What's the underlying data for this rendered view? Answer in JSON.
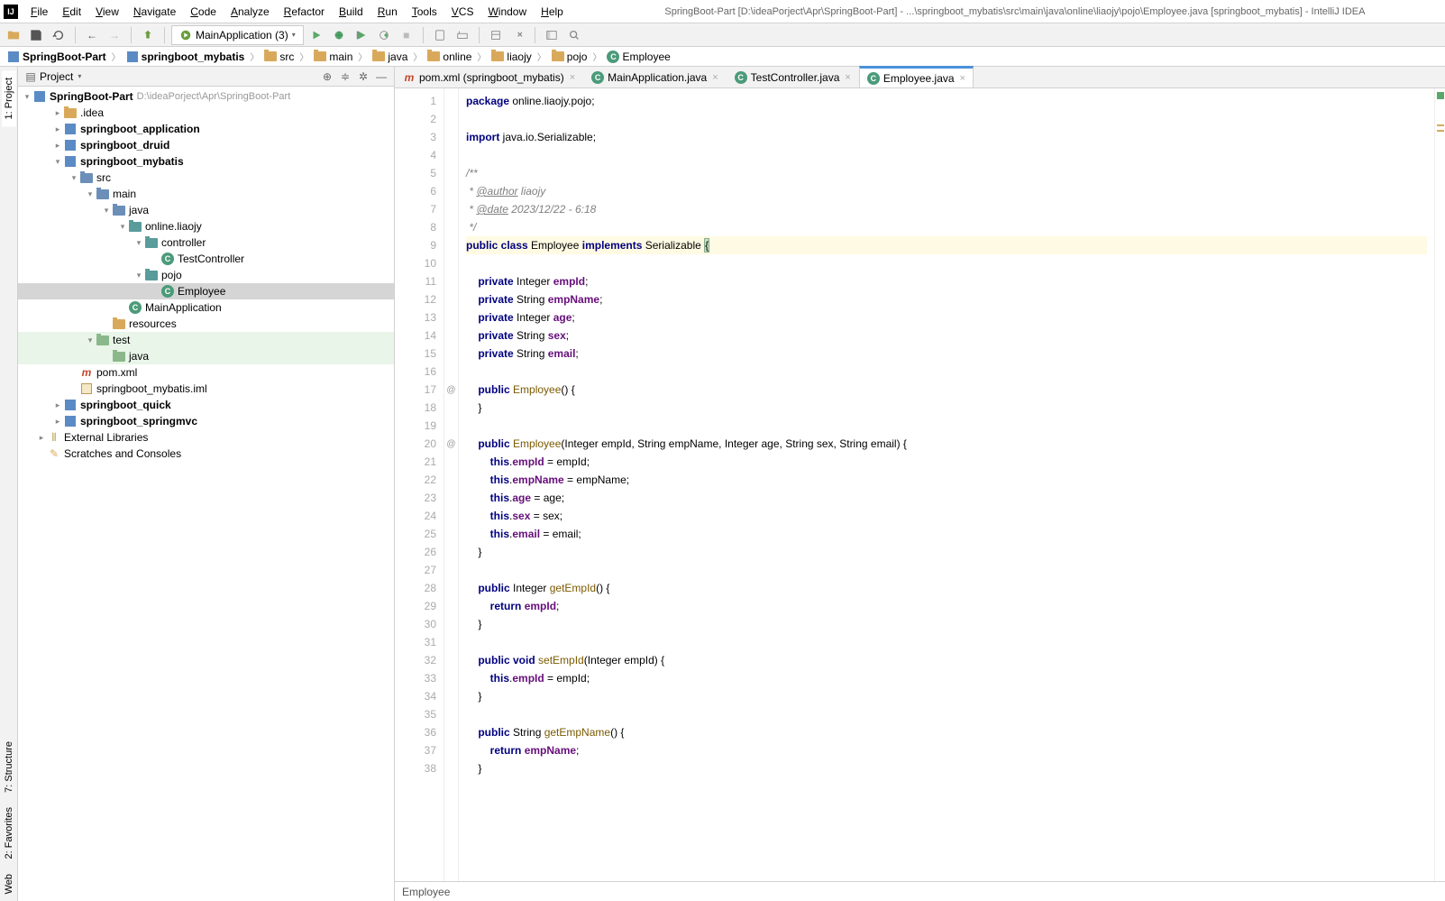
{
  "window": {
    "title": "SpringBoot-Part [D:\\ideaPorject\\Apr\\SpringBoot-Part] - ...\\springboot_mybatis\\src\\main\\java\\online\\liaojy\\pojo\\Employee.java [springboot_mybatis] - IntelliJ IDEA"
  },
  "menu": [
    "File",
    "Edit",
    "View",
    "Navigate",
    "Code",
    "Analyze",
    "Refactor",
    "Build",
    "Run",
    "Tools",
    "VCS",
    "Window",
    "Help"
  ],
  "run_config": "MainApplication (3)",
  "breadcrumb": [
    "SpringBoot-Part",
    "springboot_mybatis",
    "src",
    "main",
    "java",
    "online",
    "liaojy",
    "pojo",
    "Employee"
  ],
  "project_panel": {
    "title": "Project",
    "root": {
      "name": "SpringBoot-Part",
      "hint": "D:\\ideaPorject\\Apr\\SpringBoot-Part"
    },
    "items": [
      {
        "indent": 1,
        "arrow": ">",
        "icon": "folder",
        "label": ".idea"
      },
      {
        "indent": 1,
        "arrow": ">",
        "icon": "module",
        "label": "springboot_application",
        "bold": true
      },
      {
        "indent": 1,
        "arrow": ">",
        "icon": "module",
        "label": "springboot_druid",
        "bold": true
      },
      {
        "indent": 1,
        "arrow": "v",
        "icon": "module",
        "label": "springboot_mybatis",
        "bold": true
      },
      {
        "indent": 2,
        "arrow": "v",
        "icon": "folder-blue",
        "label": "src"
      },
      {
        "indent": 3,
        "arrow": "v",
        "icon": "folder-blue",
        "label": "main"
      },
      {
        "indent": 4,
        "arrow": "v",
        "icon": "folder-blue",
        "label": "java"
      },
      {
        "indent": 5,
        "arrow": "v",
        "icon": "folder-teal",
        "label": "online.liaojy"
      },
      {
        "indent": 6,
        "arrow": "v",
        "icon": "folder-teal",
        "label": "controller"
      },
      {
        "indent": 7,
        "arrow": "",
        "icon": "class",
        "label": "TestController"
      },
      {
        "indent": 6,
        "arrow": "v",
        "icon": "folder-teal",
        "label": "pojo"
      },
      {
        "indent": 7,
        "arrow": "",
        "icon": "class",
        "label": "Employee",
        "selected": true
      },
      {
        "indent": 5,
        "arrow": "",
        "icon": "class-run",
        "label": "MainApplication"
      },
      {
        "indent": 4,
        "arrow": "",
        "icon": "folder",
        "label": "resources"
      },
      {
        "indent": 3,
        "arrow": "v",
        "icon": "folder-green",
        "label": "test",
        "test": true
      },
      {
        "indent": 4,
        "arrow": "",
        "icon": "folder-green",
        "label": "java",
        "test": true
      },
      {
        "indent": 2,
        "arrow": "",
        "icon": "maven",
        "label": "pom.xml"
      },
      {
        "indent": 2,
        "arrow": "",
        "icon": "iml",
        "label": "springboot_mybatis.iml"
      },
      {
        "indent": 1,
        "arrow": ">",
        "icon": "module",
        "label": "springboot_quick",
        "bold": true
      },
      {
        "indent": 1,
        "arrow": ">",
        "icon": "module",
        "label": "springboot_springmvc",
        "bold": true
      },
      {
        "indent": 0,
        "arrow": ">",
        "icon": "lib",
        "label": "External Libraries"
      },
      {
        "indent": 0,
        "arrow": "",
        "icon": "scratch",
        "label": "Scratches and Consoles"
      }
    ]
  },
  "editor_tabs": [
    {
      "label": "pom.xml (springboot_mybatis)",
      "icon": "maven",
      "active": false
    },
    {
      "label": "MainApplication.java",
      "icon": "class-run",
      "active": false
    },
    {
      "label": "TestController.java",
      "icon": "class",
      "active": false
    },
    {
      "label": "Employee.java",
      "icon": "class",
      "active": true
    }
  ],
  "code": {
    "lines": [
      {
        "n": 1,
        "t": [
          [
            "kw",
            "package"
          ],
          [
            "",
            " online.liaojy.pojo;"
          ]
        ]
      },
      {
        "n": 2,
        "t": []
      },
      {
        "n": 3,
        "t": [
          [
            "kw",
            "import"
          ],
          [
            "",
            " java.io.Serializable;"
          ]
        ]
      },
      {
        "n": 4,
        "t": []
      },
      {
        "n": 5,
        "t": [
          [
            "cmt",
            "/**"
          ]
        ]
      },
      {
        "n": 6,
        "t": [
          [
            "cmt",
            " * "
          ],
          [
            "cmt tag",
            "@author"
          ],
          [
            "cmt",
            " liaojy"
          ]
        ]
      },
      {
        "n": 7,
        "t": [
          [
            "cmt",
            " * "
          ],
          [
            "cmt tag",
            "@date"
          ],
          [
            "cmt",
            " 2023/12/22 - 6:18"
          ]
        ]
      },
      {
        "n": 8,
        "t": [
          [
            "cmt",
            " */"
          ]
        ]
      },
      {
        "n": 9,
        "hl": true,
        "t": [
          [
            "kw",
            "public class"
          ],
          [
            "",
            " Employee "
          ],
          [
            "kw",
            "implements"
          ],
          [
            "",
            " Serializable "
          ],
          [
            "bracket",
            "{"
          ]
        ]
      },
      {
        "n": 10,
        "t": []
      },
      {
        "n": 11,
        "t": [
          [
            "",
            "    "
          ],
          [
            "kw",
            "private"
          ],
          [
            "",
            " Integer "
          ],
          [
            "name",
            "empId"
          ],
          [
            "",
            ";"
          ]
        ]
      },
      {
        "n": 12,
        "t": [
          [
            "",
            "    "
          ],
          [
            "kw",
            "private"
          ],
          [
            "",
            " String "
          ],
          [
            "name",
            "empName"
          ],
          [
            "",
            ";"
          ]
        ]
      },
      {
        "n": 13,
        "t": [
          [
            "",
            "    "
          ],
          [
            "kw",
            "private"
          ],
          [
            "",
            " Integer "
          ],
          [
            "name",
            "age"
          ],
          [
            "",
            ";"
          ]
        ]
      },
      {
        "n": 14,
        "t": [
          [
            "",
            "    "
          ],
          [
            "kw",
            "private"
          ],
          [
            "",
            " String "
          ],
          [
            "name",
            "sex"
          ],
          [
            "",
            ";"
          ]
        ]
      },
      {
        "n": 15,
        "t": [
          [
            "",
            "    "
          ],
          [
            "kw",
            "private"
          ],
          [
            "",
            " String "
          ],
          [
            "name",
            "email"
          ],
          [
            "",
            ";"
          ]
        ]
      },
      {
        "n": 16,
        "t": []
      },
      {
        "n": 17,
        "mark": "@",
        "t": [
          [
            "",
            "    "
          ],
          [
            "kw",
            "public"
          ],
          [
            "",
            " "
          ],
          [
            "method",
            "Employee"
          ],
          [
            "",
            "() {"
          ]
        ]
      },
      {
        "n": 18,
        "t": [
          [
            "",
            "    }"
          ]
        ]
      },
      {
        "n": 19,
        "t": []
      },
      {
        "n": 20,
        "mark": "@",
        "t": [
          [
            "",
            "    "
          ],
          [
            "kw",
            "public"
          ],
          [
            "",
            " "
          ],
          [
            "method",
            "Employee"
          ],
          [
            "",
            "(Integer empId, String empName, Integer age, String sex, String email) {"
          ]
        ]
      },
      {
        "n": 21,
        "t": [
          [
            "",
            "        "
          ],
          [
            "kw",
            "this"
          ],
          [
            "",
            ". "
          ],
          [
            "name",
            "empId"
          ],
          [
            "",
            " = empId;"
          ]
        ],
        "fix": true
      },
      {
        "n": 22,
        "t": [
          [
            "",
            "        "
          ],
          [
            "kw",
            "this"
          ],
          [
            "",
            ". "
          ],
          [
            "name",
            "empName"
          ],
          [
            "",
            " = empName;"
          ]
        ],
        "fix": true
      },
      {
        "n": 23,
        "t": [
          [
            "",
            "        "
          ],
          [
            "kw",
            "this"
          ],
          [
            "",
            ". "
          ],
          [
            "name",
            "age"
          ],
          [
            "",
            " = age;"
          ]
        ],
        "fix": true
      },
      {
        "n": 24,
        "t": [
          [
            "",
            "        "
          ],
          [
            "kw",
            "this"
          ],
          [
            "",
            ". "
          ],
          [
            "name",
            "sex"
          ],
          [
            "",
            " = sex;"
          ]
        ],
        "fix": true
      },
      {
        "n": 25,
        "t": [
          [
            "",
            "        "
          ],
          [
            "kw",
            "this"
          ],
          [
            "",
            ". "
          ],
          [
            "name",
            "email"
          ],
          [
            "",
            " = email;"
          ]
        ],
        "fix": true
      },
      {
        "n": 26,
        "t": [
          [
            "",
            "    }"
          ]
        ]
      },
      {
        "n": 27,
        "t": []
      },
      {
        "n": 28,
        "t": [
          [
            "",
            "    "
          ],
          [
            "kw",
            "public"
          ],
          [
            "",
            " Integer "
          ],
          [
            "method",
            "getEmpId"
          ],
          [
            "",
            "() {"
          ]
        ]
      },
      {
        "n": 29,
        "t": [
          [
            "",
            "        "
          ],
          [
            "kw",
            "return"
          ],
          [
            "",
            " "
          ],
          [
            "name",
            "empId"
          ],
          [
            "",
            ";"
          ]
        ]
      },
      {
        "n": 30,
        "t": [
          [
            "",
            "    }"
          ]
        ]
      },
      {
        "n": 31,
        "t": []
      },
      {
        "n": 32,
        "t": [
          [
            "",
            "    "
          ],
          [
            "kw",
            "public void"
          ],
          [
            "",
            " "
          ],
          [
            "method",
            "setEmpId"
          ],
          [
            "",
            "(Integer empId) {"
          ]
        ]
      },
      {
        "n": 33,
        "t": [
          [
            "",
            "        "
          ],
          [
            "kw",
            "this"
          ],
          [
            "",
            ". "
          ],
          [
            "name",
            "empId"
          ],
          [
            "",
            " = empId;"
          ]
        ],
        "fix": true
      },
      {
        "n": 34,
        "t": [
          [
            "",
            "    }"
          ]
        ]
      },
      {
        "n": 35,
        "t": []
      },
      {
        "n": 36,
        "t": [
          [
            "",
            "    "
          ],
          [
            "kw",
            "public"
          ],
          [
            "",
            " String "
          ],
          [
            "method",
            "getEmpName"
          ],
          [
            "",
            "() {"
          ]
        ]
      },
      {
        "n": 37,
        "t": [
          [
            "",
            "        "
          ],
          [
            "kw",
            "return"
          ],
          [
            "",
            " "
          ],
          [
            "name",
            "empName"
          ],
          [
            "",
            ";"
          ]
        ]
      },
      {
        "n": 38,
        "t": [
          [
            "",
            "    }"
          ]
        ],
        "cut": true
      }
    ]
  },
  "status": {
    "breadcrumb": "Employee"
  },
  "left_tabs": [
    "1: Project",
    "7: Structure",
    "2: Favorites",
    "Web"
  ]
}
